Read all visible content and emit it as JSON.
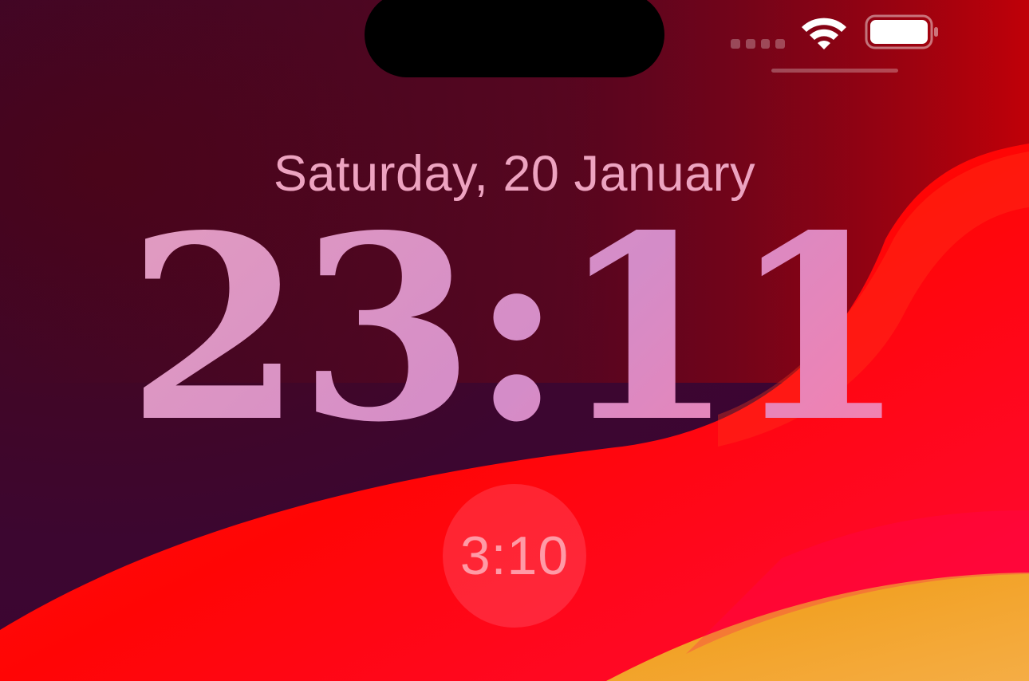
{
  "lock_screen": {
    "date": "Saturday, 20 January",
    "time": "23:11",
    "widget": {
      "text": "3:10"
    }
  },
  "status_bar": {
    "wifi_icon": "wifi-icon",
    "battery_icon": "battery-icon",
    "signal_icon": "cellular-signal-icon"
  },
  "colors": {
    "wallpaper_dark": "#3a0a2a",
    "wallpaper_red": "#ff0a12",
    "wallpaper_orange": "#f5a623",
    "time_tint": "#df98c4",
    "date_tint": "#eda3c0"
  }
}
